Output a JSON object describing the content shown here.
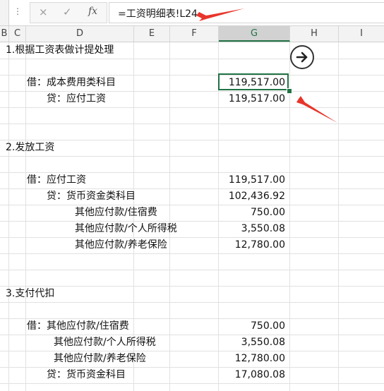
{
  "formula_bar": {
    "dots": "⋮",
    "cancel_icon": "×",
    "enter_icon": "✓",
    "fx_label": "fx",
    "formula": "=工资明细表!L24"
  },
  "columns": [
    "B",
    "C",
    "D",
    "E",
    "F",
    "G",
    "H",
    "I"
  ],
  "selected_column": "G",
  "rows": [
    {
      "label": "1.根据工资表做计提处理",
      "value": ""
    },
    {
      "label": "借：成本费用类科目",
      "value": "119,517.00"
    },
    {
      "label": "贷：应付工资",
      "value": "119,517.00"
    },
    {
      "label": "2.发放工资",
      "value": ""
    },
    {
      "label": "借：应付工资",
      "value": "119,517.00"
    },
    {
      "label": "贷：货币资金类科目",
      "value": "102,436.92"
    },
    {
      "label": "其他应付款/住宿费",
      "value": "750.00"
    },
    {
      "label": "其他应付款/个人所得税",
      "value": "3,550.08"
    },
    {
      "label": "其他应付款/养老保险",
      "value": "12,780.00"
    },
    {
      "label": "3.支付代扣",
      "value": ""
    },
    {
      "label": "借：其他应付款/住宿费",
      "value": "750.00"
    },
    {
      "label": "其他应付款/个人所得税",
      "value": "3,550.08"
    },
    {
      "label": "其他应付款/养老保险",
      "value": "12,780.00"
    },
    {
      "label": "贷：货币资金科目",
      "value": "17,080.08"
    }
  ],
  "colors": {
    "accent": "#217346",
    "annotation": "#e8352b"
  },
  "icons": {
    "quick_analysis": "arrow-right-circle-icon",
    "annotation": "red-arrow-icon"
  }
}
